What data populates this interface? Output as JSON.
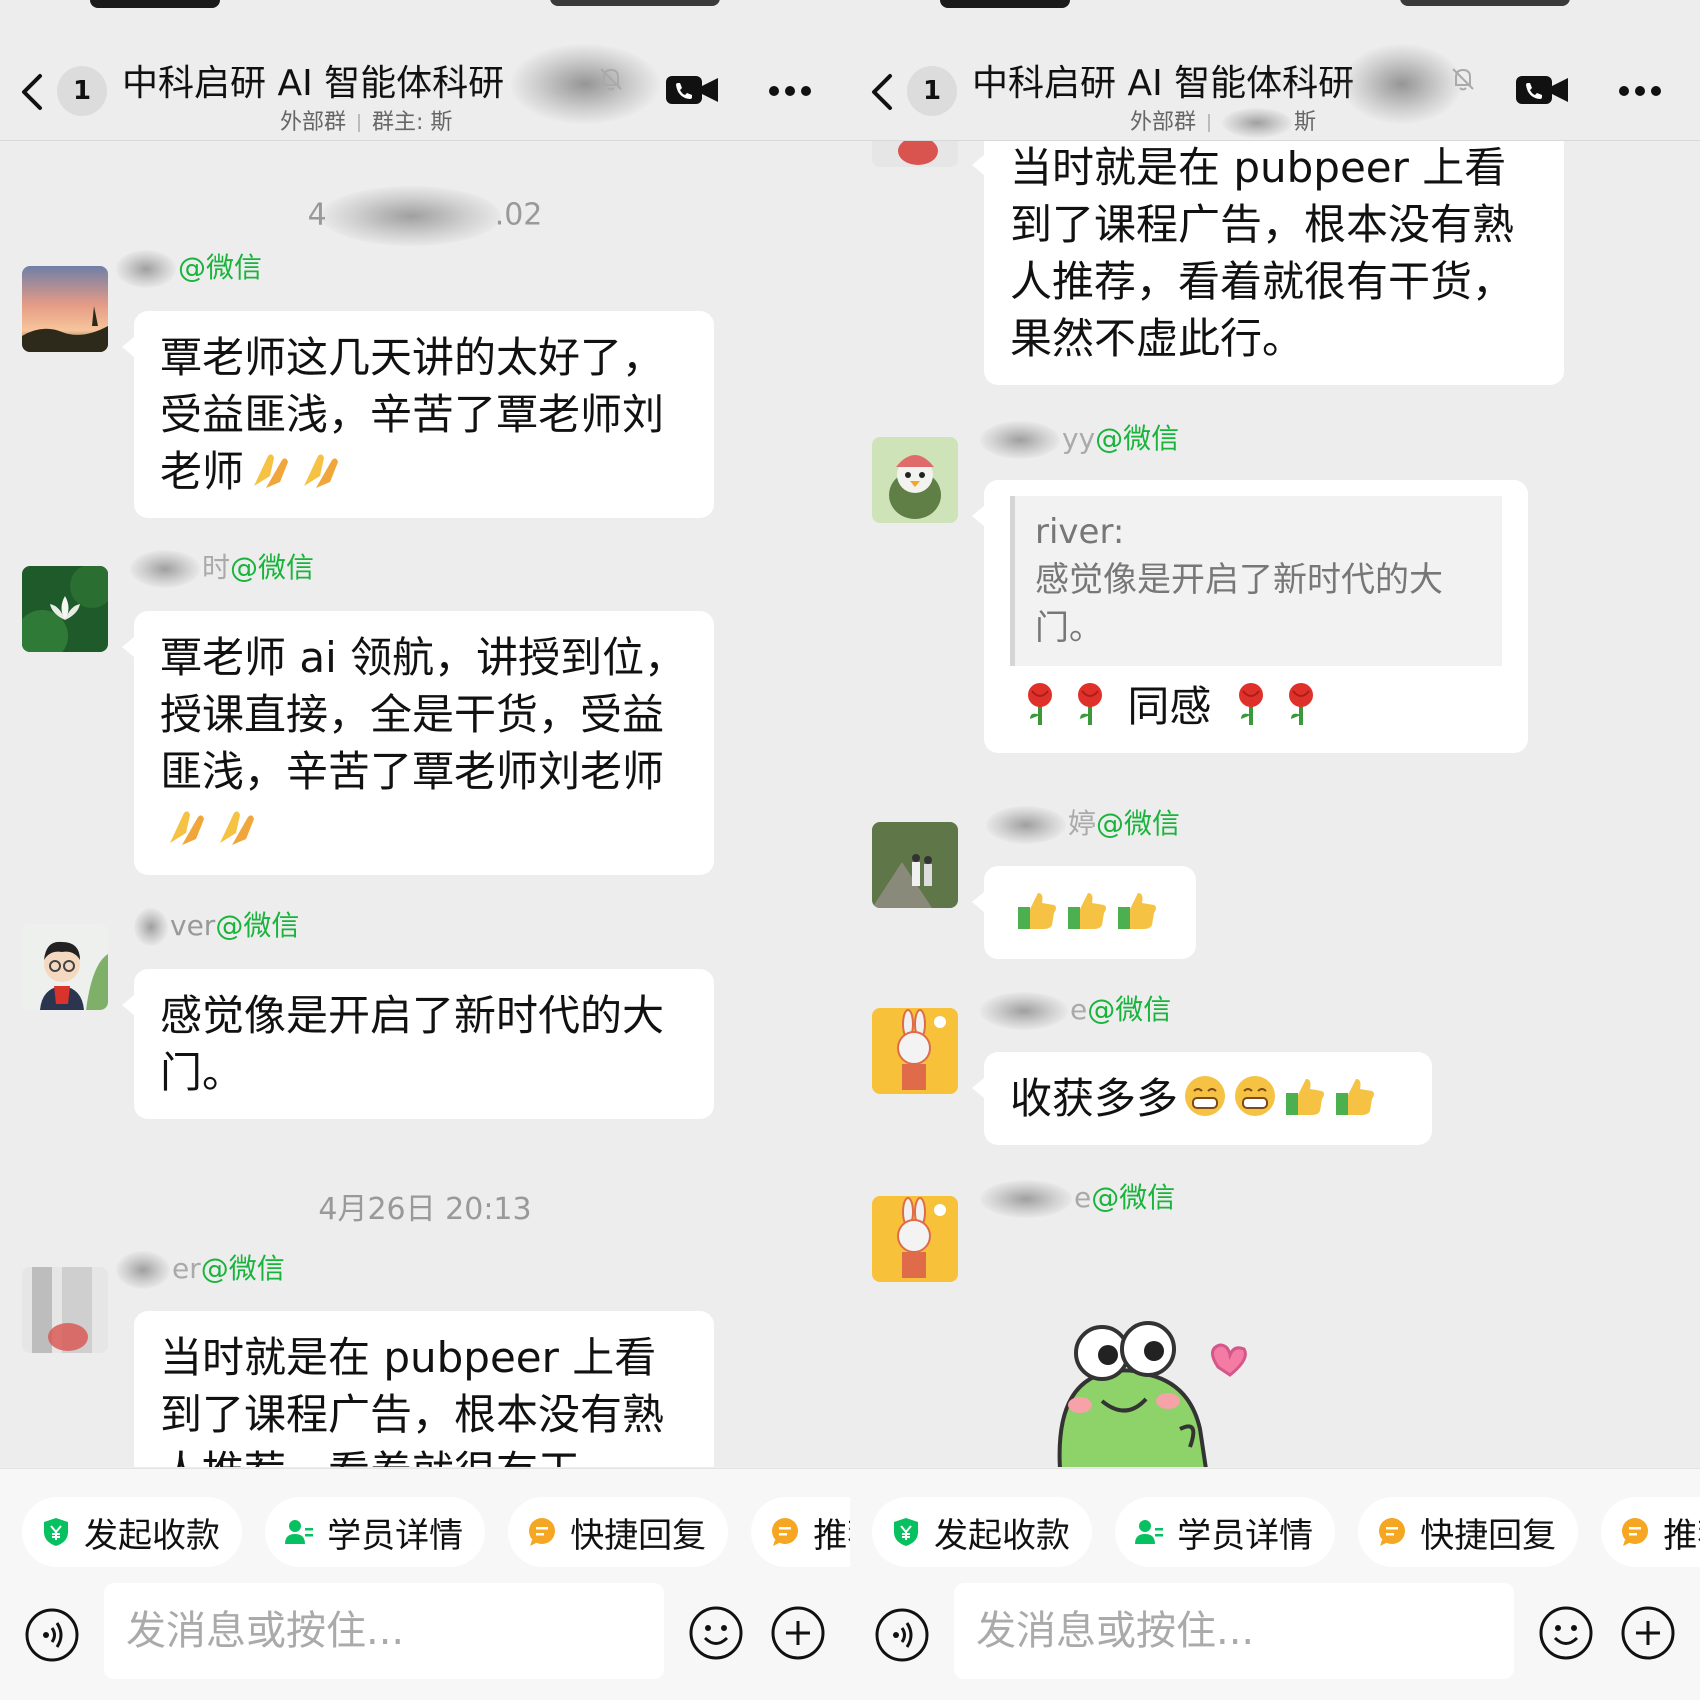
{
  "header": {
    "unread_count": "1",
    "title": "中科启研 AI 智能体科研",
    "subtitle_left": "外部群",
    "subtitle_right_left": "群主: 斯",
    "subtitle_right_right": "斯"
  },
  "left_chat": {
    "timestamp_top": "4",
    "timestamp_top_tail": ".02",
    "messages": [
      {
        "sender_suffix": "@微信",
        "text": "覃老师这几天讲的太好了，受益匪浅，辛苦了覃老师刘老师",
        "emojis": [
          "praying-hands-emoji",
          "praying-hands-emoji"
        ]
      },
      {
        "sender_visible": "时",
        "sender_suffix": "@微信",
        "text": "覃老师 ai 领航，讲授到位，授课直接，全是干货，受益匪浅，辛苦了覃老师刘老师",
        "emojis": [
          "praying-hands-emoji",
          "praying-hands-emoji"
        ]
      },
      {
        "sender_visible": "ver",
        "sender_suffix": "@微信",
        "text": "感觉像是开启了新时代的大门。"
      }
    ],
    "timestamp_mid": "4月26日 20:13",
    "last_message": {
      "sender_visible": "er",
      "sender_suffix": "@微信",
      "text": "当时就是在 pubpeer 上看到了课程广告，根本没有熟人推荐，看着就很有干"
    }
  },
  "right_chat": {
    "top_message_text": "当时就是在 pubpeer 上看到了课程广告，根本没有熟人推荐，看着就很有干货，果然不虚此行。",
    "messages": [
      {
        "sender_visible": "yy",
        "sender_suffix": "@微信",
        "quote_author": "river:",
        "quote_text": "感觉像是开启了新时代的大门。",
        "text": "同感",
        "emojis": [
          "rose-emoji",
          "rose-emoji",
          "rose-emoji",
          "rose-emoji"
        ]
      },
      {
        "sender_visible": "婷",
        "sender_suffix": "@微信",
        "emojis": [
          "thumbs-up-emoji",
          "thumbs-up-emoji",
          "thumbs-up-emoji"
        ]
      },
      {
        "sender_visible": "e",
        "sender_suffix": "@微信",
        "text": "收获多多",
        "emojis": [
          "grin-emoji",
          "grin-emoji",
          "thumbs-up-emoji",
          "thumbs-up-emoji"
        ]
      },
      {
        "sender_visible": "e",
        "sender_suffix": "@微信",
        "sticker": "frog-heart-sticker"
      }
    ]
  },
  "toolbar": {
    "chips": [
      {
        "label": "发起收款",
        "icon": "shield-yen-icon"
      },
      {
        "label": "学员详情",
        "icon": "person-list-icon"
      },
      {
        "label": "快捷回复",
        "icon": "chat-bubble-icon"
      },
      {
        "label": "推荐",
        "icon": "chat-bubble-icon"
      }
    ],
    "input_placeholder": "发消息或按住..."
  },
  "colors": {
    "wechat_green": "#19b43c",
    "chat_background": "#ededed",
    "bubble": "#ffffff",
    "chip_icon_orange": "#f5a623",
    "chip_icon_green": "#07c160"
  }
}
